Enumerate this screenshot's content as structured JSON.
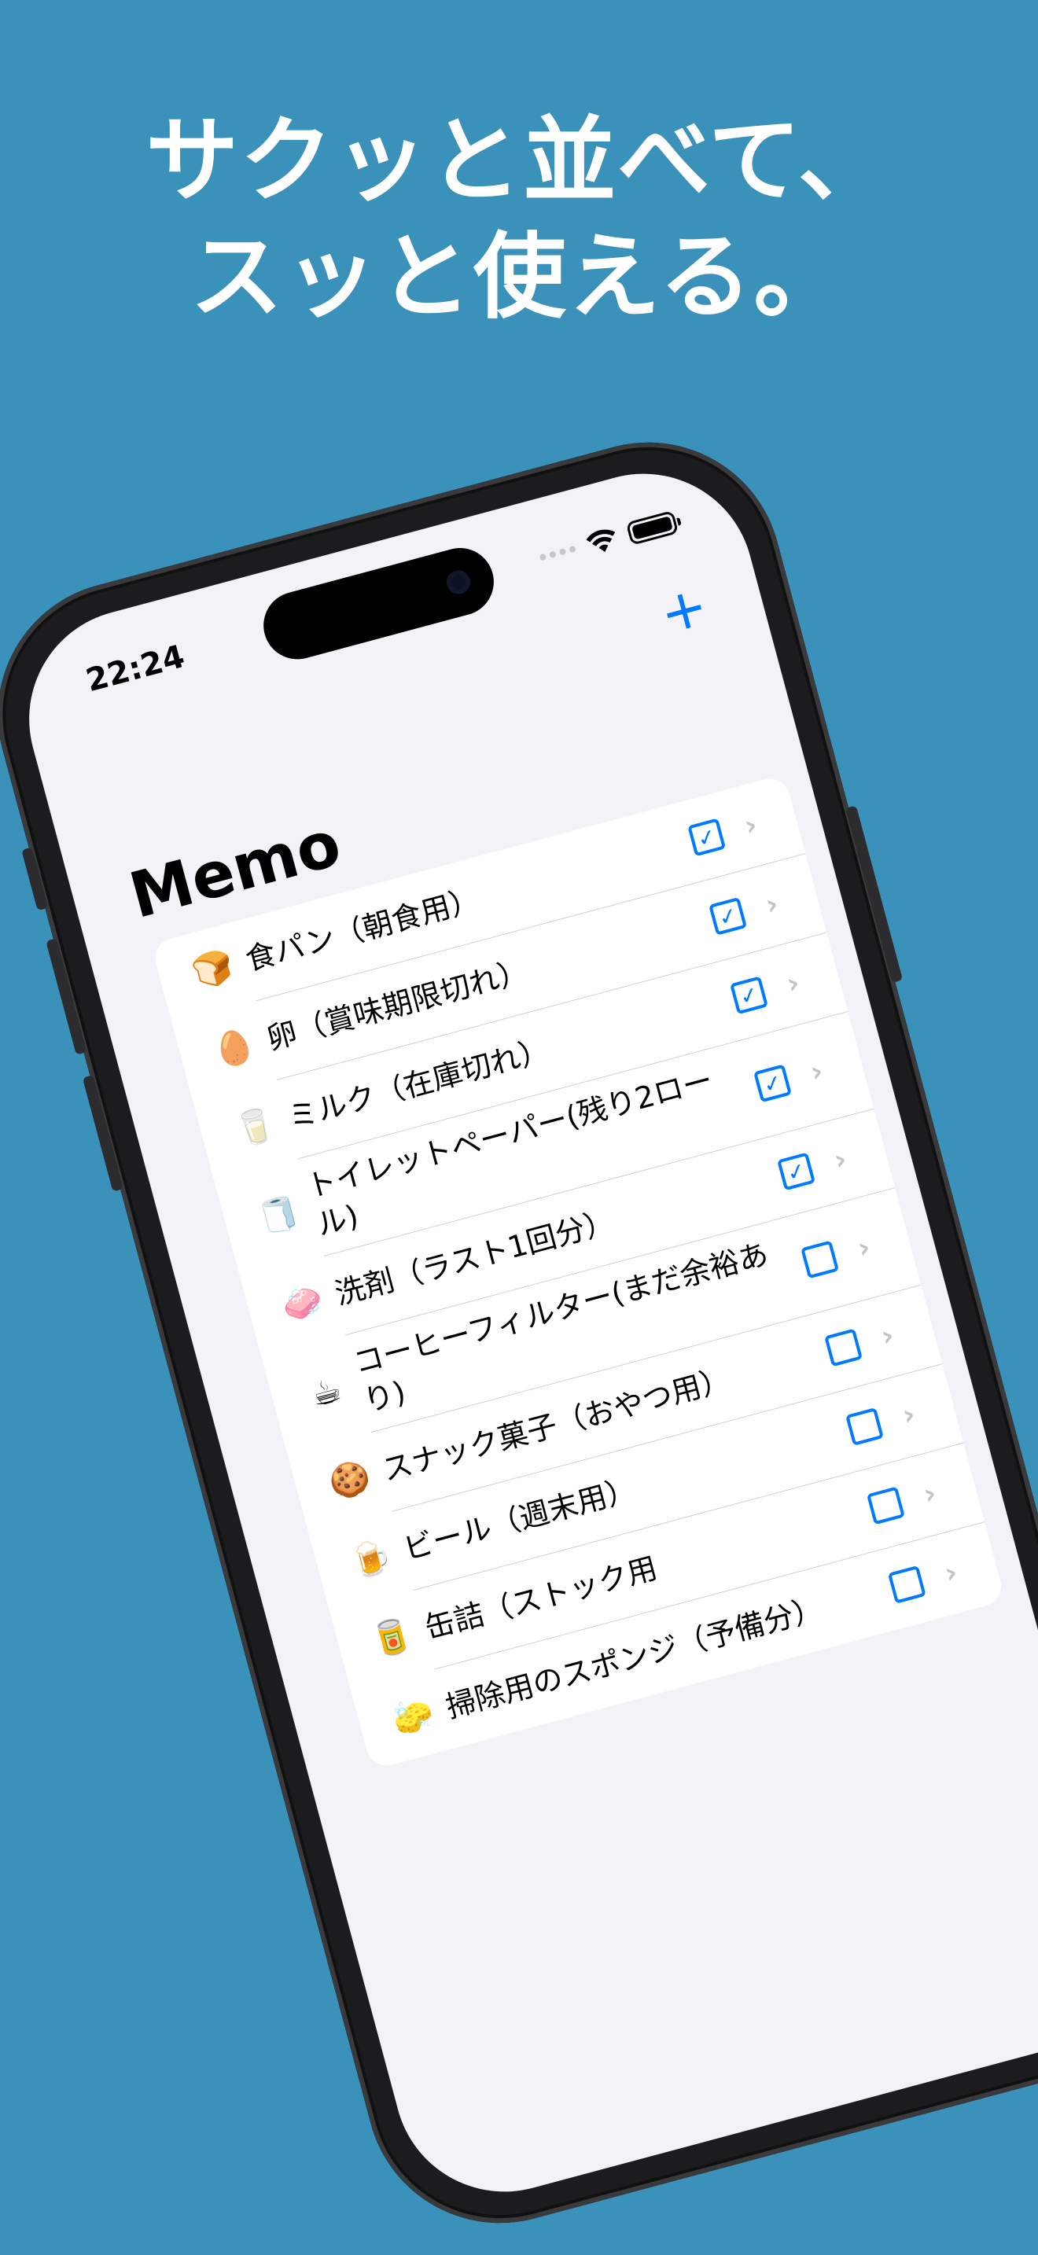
{
  "headline": {
    "line1": "サクッと並べて、",
    "line2": "スッと使える。"
  },
  "status_bar": {
    "time": "22:24"
  },
  "nav": {
    "title": "Memo",
    "add_label": "+"
  },
  "list": {
    "items": [
      {
        "emoji": "🍞",
        "label": "食パン（朝食用）",
        "checked": true,
        "check_mark": "✓",
        "chevron": "›"
      },
      {
        "emoji": "🥚",
        "label": "卵（賞味期限切れ）",
        "checked": true,
        "check_mark": "✓",
        "chevron": "›"
      },
      {
        "emoji": "🥛",
        "label": "ミルク（在庫切れ）",
        "checked": true,
        "check_mark": "✓",
        "chevron": "›"
      },
      {
        "emoji": "🧻",
        "label": "トイレットペーパー(残り2ロール)",
        "checked": true,
        "check_mark": "✓",
        "chevron": "›"
      },
      {
        "emoji": "🧼",
        "label": "洗剤（ラスト1回分）",
        "checked": true,
        "check_mark": "✓",
        "chevron": "›"
      },
      {
        "emoji": "☕",
        "label": "コーヒーフィルター(まだ余裕あり)",
        "checked": false,
        "check_mark": "",
        "chevron": "›"
      },
      {
        "emoji": "🍪",
        "label": "スナック菓子（おやつ用）",
        "checked": false,
        "check_mark": "",
        "chevron": "›"
      },
      {
        "emoji": "🍺",
        "label": "ビール（週末用）",
        "checked": false,
        "check_mark": "",
        "chevron": "›"
      },
      {
        "emoji": "🥫",
        "label": "缶詰（ストック用",
        "checked": false,
        "check_mark": "",
        "chevron": "›"
      },
      {
        "emoji": "🧽",
        "label": "掃除用のスポンジ（予備分）",
        "checked": false,
        "check_mark": "",
        "chevron": "›"
      }
    ]
  },
  "colors": {
    "background": "#3a91ba",
    "accent": "#007aff",
    "screen_bg": "#f2f2f7"
  }
}
